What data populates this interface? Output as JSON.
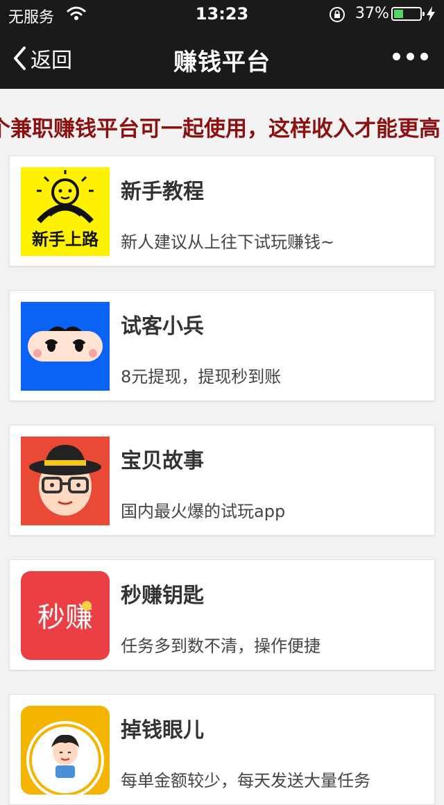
{
  "status_bar": {
    "carrier": "无服务",
    "time": "13:23",
    "battery": "37%",
    "battery_level": 0.37
  },
  "nav": {
    "back_label": "返回",
    "title": "赚钱平台"
  },
  "notice": "个兼职赚钱平台可一起使用，这样收入才能更高",
  "apps": [
    {
      "name": "新手教程",
      "desc": "新人建议从上往下试玩赚钱~",
      "icon_text": "新手上路",
      "icon": "rookie-road-icon",
      "color": "#fff200"
    },
    {
      "name": "试客小兵",
      "desc": "8元提现，提现秒到账",
      "icon": "ninja-face-icon",
      "color": "#0b63f6"
    },
    {
      "name": "宝贝故事",
      "desc": "国内最火爆的试玩app",
      "icon": "hat-glasses-face-icon",
      "color": "#e94a35"
    },
    {
      "name": "秒赚钥匙",
      "desc": "任务多到数不清，操作便捷",
      "icon_text": "秒赚",
      "icon": "miaozhuan-logo-icon",
      "color": "#ea3f44"
    },
    {
      "name": "掉钱眼儿",
      "desc": "每单金额较少，每天发送大量任务",
      "icon": "coin-boy-icon",
      "color": "#f4b400"
    }
  ]
}
